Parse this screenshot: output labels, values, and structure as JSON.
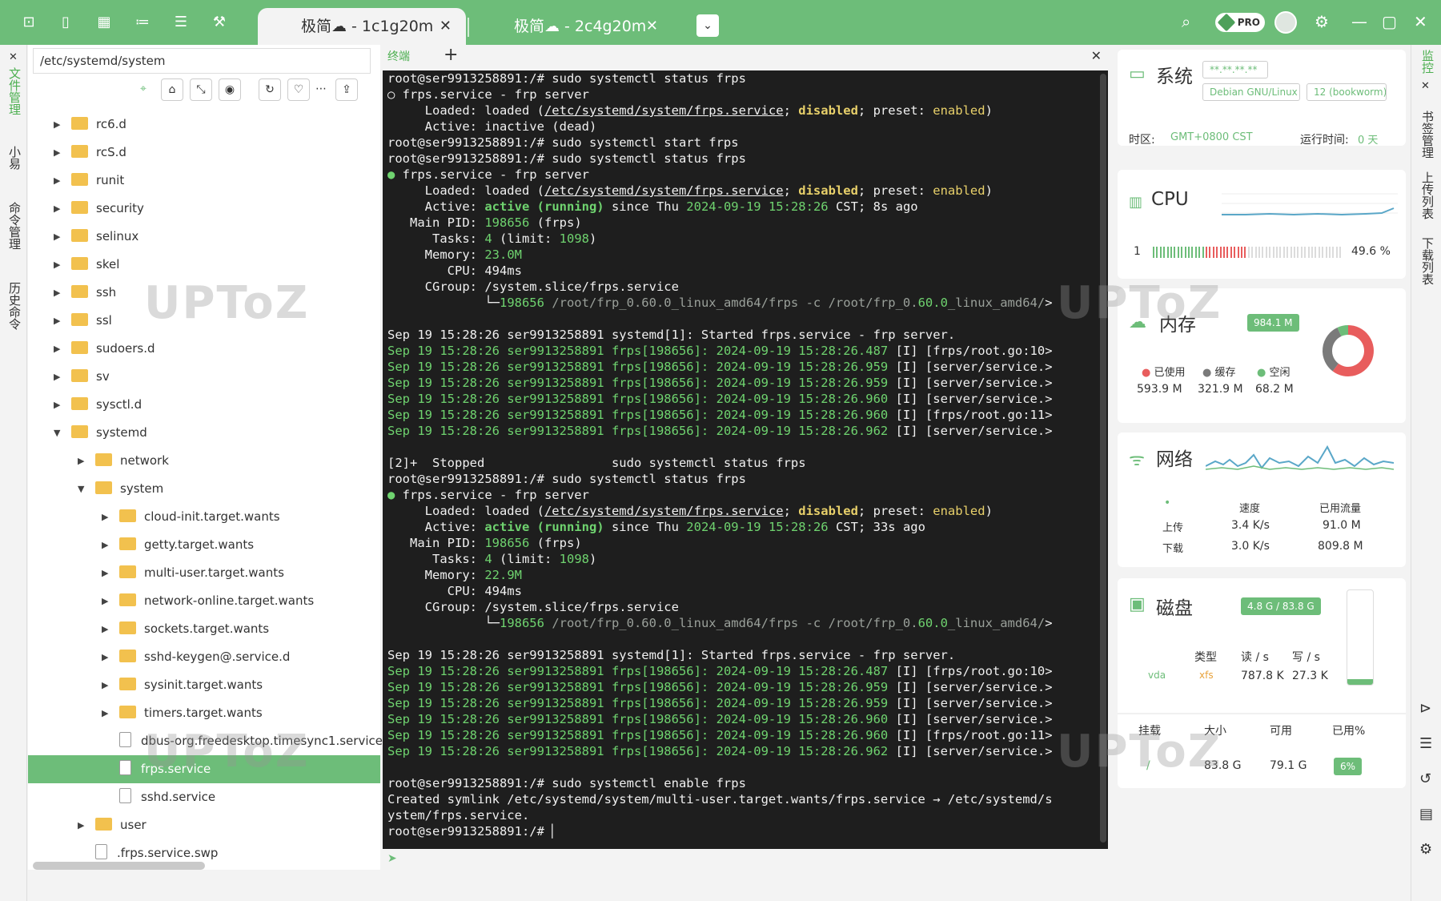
{
  "titlebar": {
    "active_tab": "极简☁ - 1c1g20m",
    "inactive_tab": "极简☁ - 2c4g20m",
    "tab_close": "✕",
    "dropdown": "⌄",
    "pro_label": "PRO"
  },
  "left_strip": {
    "items": [
      "文件管理",
      "小易",
      "命令管理",
      "历史命令"
    ],
    "close": "✕"
  },
  "file_panel": {
    "path": "/etc/systemd/system",
    "tree": [
      {
        "name": "rc6.d",
        "type": "folder",
        "level": 0,
        "expanded": false
      },
      {
        "name": "rcS.d",
        "type": "folder",
        "level": 0,
        "expanded": false
      },
      {
        "name": "runit",
        "type": "folder",
        "level": 0,
        "expanded": false
      },
      {
        "name": "security",
        "type": "folder",
        "level": 0,
        "expanded": false
      },
      {
        "name": "selinux",
        "type": "folder",
        "level": 0,
        "expanded": false
      },
      {
        "name": "skel",
        "type": "folder",
        "level": 0,
        "expanded": false
      },
      {
        "name": "ssh",
        "type": "folder",
        "level": 0,
        "expanded": false
      },
      {
        "name": "ssl",
        "type": "folder",
        "level": 0,
        "expanded": false
      },
      {
        "name": "sudoers.d",
        "type": "folder",
        "level": 0,
        "expanded": false
      },
      {
        "name": "sv",
        "type": "folder",
        "level": 0,
        "expanded": false
      },
      {
        "name": "sysctl.d",
        "type": "folder",
        "level": 0,
        "expanded": false
      },
      {
        "name": "systemd",
        "type": "folder",
        "level": 0,
        "expanded": true
      },
      {
        "name": "network",
        "type": "folder",
        "level": 1,
        "expanded": false
      },
      {
        "name": "system",
        "type": "folder",
        "level": 1,
        "expanded": true
      },
      {
        "name": "cloud-init.target.wants",
        "type": "folder",
        "level": 2,
        "expanded": false
      },
      {
        "name": "getty.target.wants",
        "type": "folder",
        "level": 2,
        "expanded": false
      },
      {
        "name": "multi-user.target.wants",
        "type": "folder",
        "level": 2,
        "expanded": false
      },
      {
        "name": "network-online.target.wants",
        "type": "folder",
        "level": 2,
        "expanded": false
      },
      {
        "name": "sockets.target.wants",
        "type": "folder",
        "level": 2,
        "expanded": false
      },
      {
        "name": "sshd-keygen@.service.d",
        "type": "folder",
        "level": 2,
        "expanded": false
      },
      {
        "name": "sysinit.target.wants",
        "type": "folder",
        "level": 2,
        "expanded": false
      },
      {
        "name": "timers.target.wants",
        "type": "folder",
        "level": 2,
        "expanded": false
      },
      {
        "name": "dbus-org.freedesktop.timesync1.service",
        "type": "file",
        "level": 2
      },
      {
        "name": "frps.service",
        "type": "file",
        "level": 2,
        "selected": true
      },
      {
        "name": "sshd.service",
        "type": "file",
        "level": 2
      },
      {
        "name": "user",
        "type": "folder",
        "level": 1,
        "expanded": false
      },
      {
        "name": ".frps.service.swp",
        "type": "file",
        "level": 1
      }
    ]
  },
  "terminal": {
    "tab_label": "终端",
    "add": "+",
    "close": "✕",
    "lines": [
      [
        [
          "root@ser9913258891:/# sudo systemctl status frps",
          ""
        ]
      ],
      [
        [
          "○ frps.service - frp server",
          ""
        ]
      ],
      [
        [
          "     Loaded: loaded (",
          ""
        ],
        [
          "/etc/systemd/system/frps.service",
          "u"
        ],
        [
          "; ",
          ""
        ],
        [
          "disabled",
          "y b"
        ],
        [
          "; preset: ",
          ""
        ],
        [
          "enabled",
          "y"
        ],
        [
          ")",
          ""
        ]
      ],
      [
        [
          "     Active: inactive (dead)",
          ""
        ]
      ],
      [
        [
          "root@ser9913258891:/# sudo systemctl start frps",
          ""
        ]
      ],
      [
        [
          "root@ser9913258891:/# sudo systemctl status frps",
          ""
        ]
      ],
      [
        [
          "● ",
          "g"
        ],
        [
          "frps.service - frp server",
          ""
        ]
      ],
      [
        [
          "     Loaded: loaded (",
          ""
        ],
        [
          "/etc/systemd/system/frps.service",
          "u"
        ],
        [
          "; ",
          ""
        ],
        [
          "disabled",
          "y b"
        ],
        [
          "; preset: ",
          ""
        ],
        [
          "enabled",
          "y"
        ],
        [
          ")",
          ""
        ]
      ],
      [
        [
          "     Active: ",
          ""
        ],
        [
          "active (running)",
          "g b"
        ],
        [
          " since Thu ",
          ""
        ],
        [
          "2024-09-19",
          "g"
        ],
        [
          " ",
          ""
        ],
        [
          "15:28:26",
          "g"
        ],
        [
          " CST; 8s ago",
          ""
        ]
      ],
      [
        [
          "   Main PID: ",
          ""
        ],
        [
          "198656",
          "g"
        ],
        [
          " (frps)",
          ""
        ]
      ],
      [
        [
          "      Tasks: ",
          ""
        ],
        [
          "4",
          "g"
        ],
        [
          " (limit: ",
          ""
        ],
        [
          "1098",
          "g"
        ],
        [
          ")",
          ""
        ]
      ],
      [
        [
          "     Memory: ",
          ""
        ],
        [
          "23.0M",
          "g"
        ]
      ],
      [
        [
          "        CPU: 494ms",
          ""
        ]
      ],
      [
        [
          "     CGroup: /system.slice/frps.service",
          ""
        ]
      ],
      [
        [
          "             └─",
          ""
        ],
        [
          "198656",
          "g"
        ],
        [
          " /root/frp_0.60.0_linux_amd64/frps -c /root/frp_0.",
          "gr"
        ],
        [
          "60.0",
          "g"
        ],
        [
          "_linux_amd64/",
          "gr"
        ],
        [
          ">",
          ""
        ]
      ],
      [
        [
          "",
          ""
        ]
      ],
      [
        [
          "Sep 19 15:28:26 ser9913258891 systemd[1]: Started frps.service - frp server.",
          ""
        ]
      ],
      [
        [
          "Sep 19 15:28:26 ser9913258891 frps[198656]: ",
          "g"
        ],
        [
          "2024-09-19 15:28:26.487",
          "g"
        ],
        [
          " [I] [frps/root.go:10",
          ""
        ],
        [
          ">",
          ""
        ]
      ],
      [
        [
          "Sep 19 15:28:26 ser9913258891 frps[198656]: ",
          "g"
        ],
        [
          "2024-09-19 15:28:26.959",
          "g"
        ],
        [
          " [I] [server/service.",
          ""
        ],
        [
          ">",
          ""
        ]
      ],
      [
        [
          "Sep 19 15:28:26 ser9913258891 frps[198656]: ",
          "g"
        ],
        [
          "2024-09-19 15:28:26.959",
          "g"
        ],
        [
          " [I] [server/service.",
          ""
        ],
        [
          ">",
          ""
        ]
      ],
      [
        [
          "Sep 19 15:28:26 ser9913258891 frps[198656]: ",
          "g"
        ],
        [
          "2024-09-19 15:28:26.960",
          "g"
        ],
        [
          " [I] [server/service.",
          ""
        ],
        [
          ">",
          ""
        ]
      ],
      [
        [
          "Sep 19 15:28:26 ser9913258891 frps[198656]: ",
          "g"
        ],
        [
          "2024-09-19 15:28:26.960",
          "g"
        ],
        [
          " [I] [frps/root.go:11",
          ""
        ],
        [
          ">",
          ""
        ]
      ],
      [
        [
          "Sep 19 15:28:26 ser9913258891 frps[198656]: ",
          "g"
        ],
        [
          "2024-09-19 15:28:26.962",
          "g"
        ],
        [
          " [I] [server/service.",
          ""
        ],
        [
          ">",
          ""
        ]
      ],
      [
        [
          "",
          ""
        ]
      ],
      [
        [
          "[2]+  Stopped                 sudo systemctl status frps",
          ""
        ]
      ],
      [
        [
          "root@ser9913258891:/# sudo systemctl status frps",
          ""
        ]
      ],
      [
        [
          "● ",
          "g"
        ],
        [
          "frps.service - frp server",
          ""
        ]
      ],
      [
        [
          "     Loaded: loaded (",
          ""
        ],
        [
          "/etc/systemd/system/frps.service",
          "u"
        ],
        [
          "; ",
          ""
        ],
        [
          "disabled",
          "y b"
        ],
        [
          "; preset: ",
          ""
        ],
        [
          "enabled",
          "y"
        ],
        [
          ")",
          ""
        ]
      ],
      [
        [
          "     Active: ",
          ""
        ],
        [
          "active (running)",
          "g b"
        ],
        [
          " since Thu ",
          ""
        ],
        [
          "2024-09-19",
          "g"
        ],
        [
          " ",
          ""
        ],
        [
          "15:28:26",
          "g"
        ],
        [
          " CST; 33s ago",
          ""
        ]
      ],
      [
        [
          "   Main PID: ",
          ""
        ],
        [
          "198656",
          "g"
        ],
        [
          " (frps)",
          ""
        ]
      ],
      [
        [
          "      Tasks: ",
          ""
        ],
        [
          "4",
          "g"
        ],
        [
          " (limit: ",
          ""
        ],
        [
          "1098",
          "g"
        ],
        [
          ")",
          ""
        ]
      ],
      [
        [
          "     Memory: ",
          ""
        ],
        [
          "22.9M",
          "g"
        ]
      ],
      [
        [
          "        CPU: 494ms",
          ""
        ]
      ],
      [
        [
          "     CGroup: /system.slice/frps.service",
          ""
        ]
      ],
      [
        [
          "             └─",
          ""
        ],
        [
          "198656",
          "g"
        ],
        [
          " /root/frp_0.60.0_linux_amd64/frps -c /root/frp_0.",
          "gr"
        ],
        [
          "60.0",
          "g"
        ],
        [
          "_linux_amd64/",
          "gr"
        ],
        [
          ">",
          ""
        ]
      ],
      [
        [
          "",
          ""
        ]
      ],
      [
        [
          "Sep 19 15:28:26 ser9913258891 systemd[1]: Started frps.service - frp server.",
          ""
        ]
      ],
      [
        [
          "Sep 19 15:28:26 ser9913258891 frps[198656]: ",
          "g"
        ],
        [
          "2024-09-19 15:28:26.487",
          "g"
        ],
        [
          " [I] [frps/root.go:10",
          ""
        ],
        [
          ">",
          ""
        ]
      ],
      [
        [
          "Sep 19 15:28:26 ser9913258891 frps[198656]: ",
          "g"
        ],
        [
          "2024-09-19 15:28:26.959",
          "g"
        ],
        [
          " [I] [server/service.",
          ""
        ],
        [
          ">",
          ""
        ]
      ],
      [
        [
          "Sep 19 15:28:26 ser9913258891 frps[198656]: ",
          "g"
        ],
        [
          "2024-09-19 15:28:26.959",
          "g"
        ],
        [
          " [I] [server/service.",
          ""
        ],
        [
          ">",
          ""
        ]
      ],
      [
        [
          "Sep 19 15:28:26 ser9913258891 frps[198656]: ",
          "g"
        ],
        [
          "2024-09-19 15:28:26.960",
          "g"
        ],
        [
          " [I] [server/service.",
          ""
        ],
        [
          ">",
          ""
        ]
      ],
      [
        [
          "Sep 19 15:28:26 ser9913258891 frps[198656]: ",
          "g"
        ],
        [
          "2024-09-19 15:28:26.960",
          "g"
        ],
        [
          " [I] [frps/root.go:11",
          ""
        ],
        [
          ">",
          ""
        ]
      ],
      [
        [
          "Sep 19 15:28:26 ser9913258891 frps[198656]: ",
          "g"
        ],
        [
          "2024-09-19 15:28:26.962",
          "g"
        ],
        [
          " [I] [server/service.",
          ""
        ],
        [
          ">",
          ""
        ]
      ],
      [
        [
          "",
          ""
        ]
      ],
      [
        [
          "root@ser9913258891:/# sudo systemctl enable frps",
          ""
        ]
      ],
      [
        [
          "Created symlink /etc/systemd/system/multi-user.target.wants/frps.service → /etc/systemd/s",
          ""
        ]
      ],
      [
        [
          "ystem/frps.service.",
          ""
        ]
      ],
      [
        [
          "root@ser9913258891:/# ",
          ""
        ],
        [
          "▏",
          ""
        ]
      ]
    ]
  },
  "system": {
    "title": "系统",
    "ip_masked": "**.**.**.**",
    "os": "Debian GNU/Linux",
    "version": "12 (bookworm)",
    "tz_label": "时区:",
    "tz_value": "GMT+0800  CST",
    "uptime_label": "运行时间:",
    "uptime_value": "0 天"
  },
  "cpu": {
    "title": "CPU",
    "core_index": "1",
    "usage": "49.6 %",
    "usage_fraction": 0.496
  },
  "memory": {
    "title": "内存",
    "total": "984.1 M",
    "legend": [
      "已使用",
      "缓存",
      "空闲"
    ],
    "values": [
      "593.9 M",
      "321.9 M",
      "68.2 M"
    ],
    "fractions": [
      0.6035,
      0.3271,
      0.0694
    ],
    "colors": [
      "#e85d5d",
      "#7a7a7a",
      "#6dbd79"
    ]
  },
  "network": {
    "title": "网络",
    "header_speed": "速度",
    "header_total": "已用流量",
    "up_label": "上传",
    "down_label": "下载",
    "up_speed": "3.4 K/s",
    "down_speed": "3.0 K/s",
    "up_total": "91.0 M",
    "down_total": "809.8 M"
  },
  "disk": {
    "title": "磁盘",
    "capacity": "4.8 G / 83.8 G",
    "usage_fraction": 0.06,
    "headers": [
      "类型",
      "读 / s",
      "写 / s"
    ],
    "device": "vda",
    "fstype": "xfs",
    "read": "787.8 K",
    "write": "27.3 K",
    "mount_headers": [
      "挂载",
      "大小",
      "可用",
      "已用%"
    ],
    "mount": "/",
    "size": "83.8 G",
    "avail": "79.1 G",
    "used_pct": "6%"
  },
  "right_strip": {
    "items": [
      "监控",
      "书签管理",
      "上传列表",
      "下载列表"
    ],
    "close": "✕"
  },
  "watermarks": [
    "UPToZ",
    "UPToZ",
    "UPToZ",
    "UPToZ"
  ]
}
